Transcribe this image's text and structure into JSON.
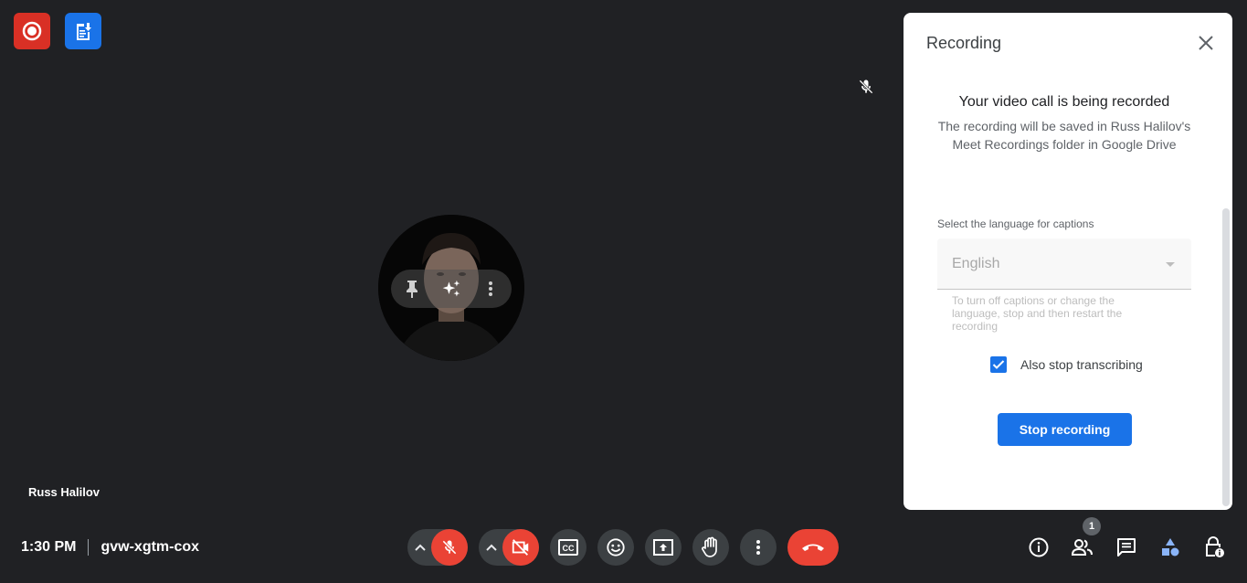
{
  "top_buttons": {
    "recording": {
      "icon": "record-icon",
      "color": "#d93025"
    },
    "notes": {
      "icon": "notes-document-icon",
      "color": "#1a73e8"
    }
  },
  "tile": {
    "participant_name": "Russ Halilov",
    "muted": true,
    "controls": [
      "pin-icon",
      "effects-sparkle-icon",
      "more-vert-icon"
    ]
  },
  "meeting": {
    "time": "1:30 PM",
    "code": "gvw-xgtm-cox"
  },
  "controls": {
    "mic": {
      "state": "off",
      "icon": "mic-off-icon"
    },
    "camera": {
      "state": "off",
      "icon": "videocam-off-icon"
    },
    "captions": {
      "icon": "closed-caption-icon"
    },
    "reactions": {
      "icon": "emoji-icon"
    },
    "present": {
      "icon": "present-screen-icon"
    },
    "raise_hand": {
      "icon": "hand-icon"
    },
    "more": {
      "icon": "more-vert-icon"
    },
    "leave": {
      "icon": "call-end-icon",
      "color": "#ea4335"
    }
  },
  "right_controls": {
    "info": {
      "icon": "info-icon"
    },
    "people": {
      "icon": "people-icon",
      "count": "1"
    },
    "chat": {
      "icon": "chat-icon"
    },
    "activities": {
      "icon": "activities-icon",
      "color": "#8ab4f8"
    },
    "host_controls": {
      "icon": "lock-person-icon"
    }
  },
  "panel": {
    "title": "Recording",
    "heading": "Your video call is being recorded",
    "description": "The recording will be saved in Russ Halilov's Meet Recordings folder in Google Drive",
    "language_label": "Select the language for captions",
    "language_value": "English",
    "language_help": "To turn off captions or change the language, stop and then restart the recording",
    "checkbox_label": "Also stop transcribing",
    "checkbox_checked": true,
    "stop_button": "Stop recording",
    "accent": "#1a73e8"
  }
}
